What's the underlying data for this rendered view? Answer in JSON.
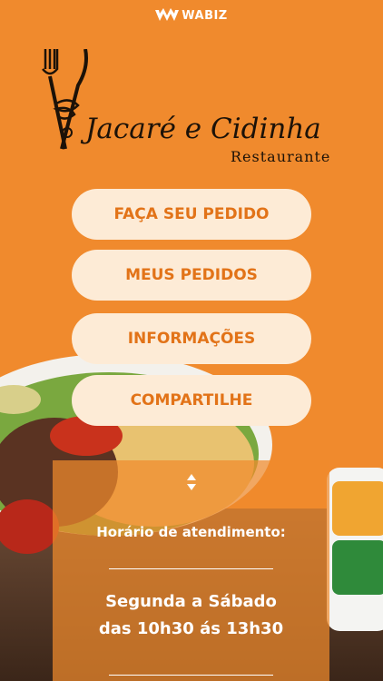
{
  "header": {
    "brand_label": "WABIZ"
  },
  "restaurant": {
    "name": "Jacaré e Cidinha",
    "subtitle": "Restaurante"
  },
  "menu": {
    "order_label": "FAÇA SEU PEDIDO",
    "my_orders_label": "MEUS PEDIDOS",
    "info_label": "INFORMAÇÕES",
    "share_label": "COMPARTILHE"
  },
  "hours": {
    "title": "Horário de atendimento:",
    "days": "Segunda a Sábado",
    "times": "das 10h30 ás 13h30"
  },
  "colors": {
    "background": "#F08A2D",
    "button_bg": "#FDEBD6",
    "button_text": "#E27318"
  }
}
